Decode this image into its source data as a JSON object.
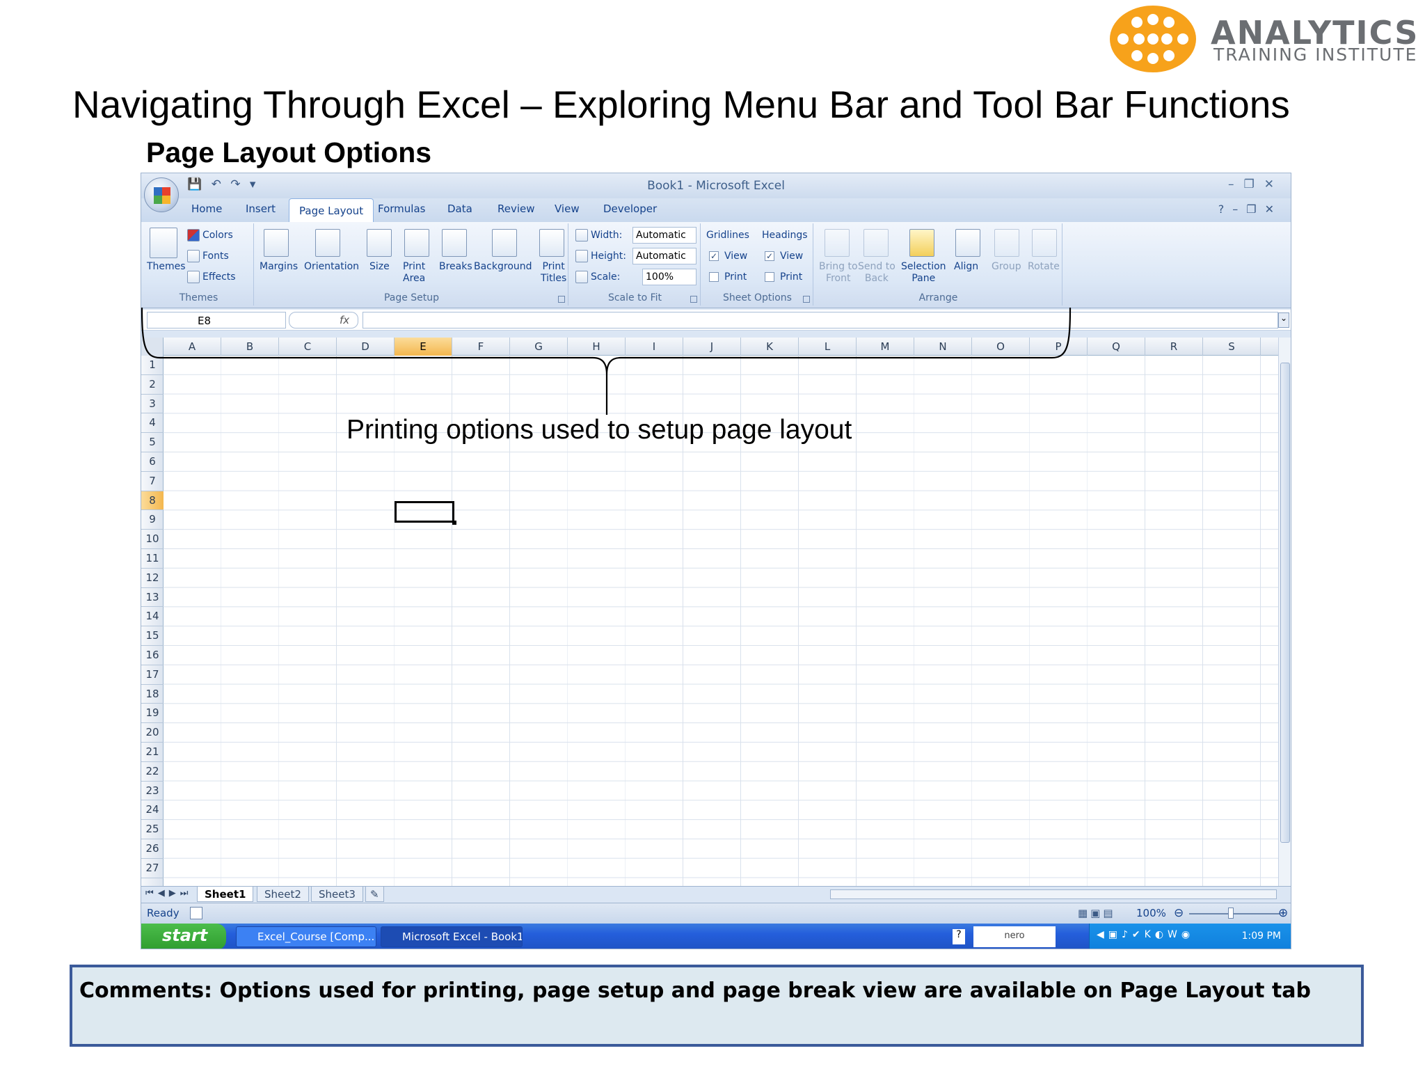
{
  "brand": {
    "line1": "ANALYTICS",
    "line2": "TRAINING INSTITUTE",
    "color": "#f7a21b"
  },
  "title": "Navigating Through Excel – Exploring Menu Bar and Tool Bar Functions",
  "subtitle": "Page Layout Options",
  "excel": {
    "window_title": "Book1 - Microsoft Excel",
    "tabs": [
      "Home",
      "Insert",
      "Page Layout",
      "Formulas",
      "Data",
      "Review",
      "View",
      "Developer"
    ],
    "active_tab": "Page Layout",
    "ribbon": {
      "themes": {
        "label": "Themes",
        "themes_btn": "Themes",
        "colors": "Colors",
        "fonts": "Fonts",
        "effects": "Effects"
      },
      "page_setup": {
        "label": "Page Setup",
        "margins": "Margins",
        "orientation": "Orientation",
        "size": "Size",
        "print_area_1": "Print",
        "print_area_2": "Area",
        "breaks": "Breaks",
        "background": "Background",
        "print_titles_1": "Print",
        "print_titles_2": "Titles"
      },
      "scale_to_fit": {
        "label": "Scale to Fit",
        "width_label": "Width:",
        "width_value": "Automatic",
        "height_label": "Height:",
        "height_value": "Automatic",
        "scale_label": "Scale:",
        "scale_value": "100%"
      },
      "sheet_options": {
        "label": "Sheet Options",
        "gridlines": "Gridlines",
        "headings": "Headings",
        "view": "View",
        "print": "Print"
      },
      "arrange": {
        "label": "Arrange",
        "bring_front_1": "Bring to",
        "bring_front_2": "Front",
        "send_back_1": "Send to",
        "send_back_2": "Back",
        "selection_1": "Selection",
        "selection_2": "Pane",
        "align": "Align",
        "group": "Group",
        "rotate": "Rotate"
      }
    },
    "name_box": "E8",
    "fx": "fx",
    "columns": [
      "A",
      "B",
      "C",
      "D",
      "E",
      "F",
      "G",
      "H",
      "I",
      "J",
      "K",
      "L",
      "M",
      "N",
      "O",
      "P",
      "Q",
      "R",
      "S"
    ],
    "selected_column": "E",
    "rows": [
      "1",
      "2",
      "3",
      "4",
      "5",
      "6",
      "7",
      "8",
      "9",
      "10",
      "11",
      "12",
      "13",
      "14",
      "15",
      "16",
      "17",
      "18",
      "19",
      "20",
      "21",
      "22",
      "23",
      "24",
      "25",
      "26",
      "27"
    ],
    "selected_row": "8",
    "sheets": [
      "Sheet1",
      "Sheet2",
      "Sheet3"
    ],
    "status": "Ready",
    "zoom": "100%",
    "taskbar": {
      "start": "start",
      "task1": "Excel_Course [Comp...",
      "task2": "Microsoft Excel - Book1",
      "clock": "1:09 PM",
      "nero": "nero"
    }
  },
  "annotation": "Printing options used to setup page layout",
  "comments": "Comments: Options used for printing, page setup and page break view are available on Page Layout tab"
}
